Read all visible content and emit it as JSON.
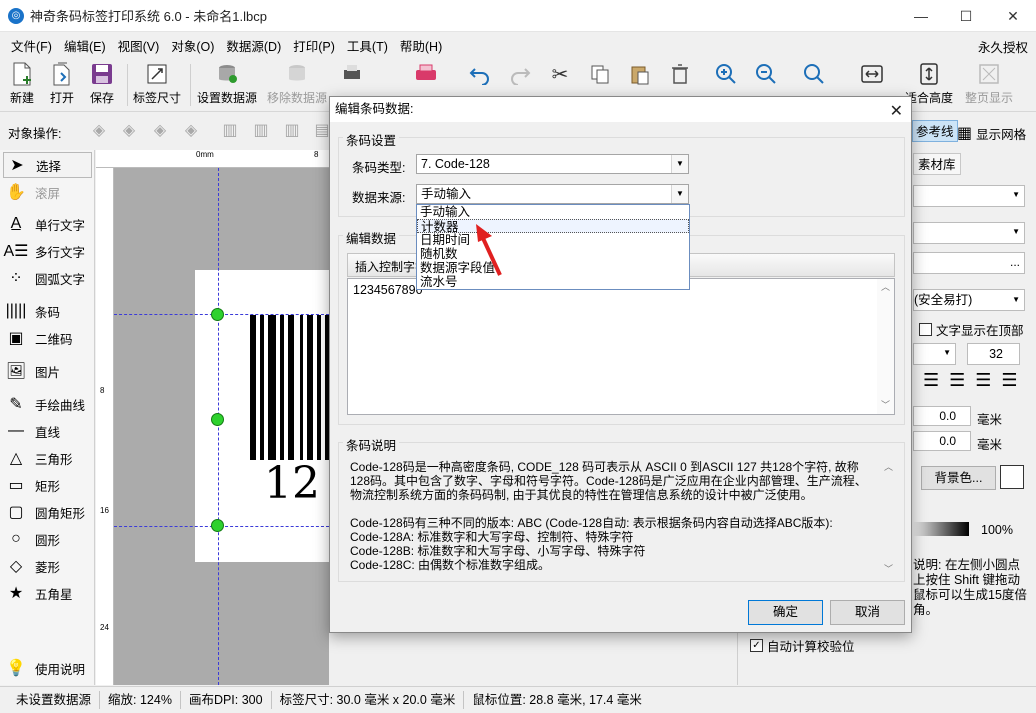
{
  "window": {
    "title": "神奇条码标签打印系统 6.0 - 未命名1.lbcp",
    "logo_glyph": "◎",
    "controls": {
      "minimize": "—",
      "maximize": "☐",
      "close": "✕"
    }
  },
  "menu": {
    "items": [
      "文件(F)",
      "编辑(E)",
      "视图(V)",
      "对象(O)",
      "数据源(D)",
      "打印(P)",
      "工具(T)",
      "帮助(H)"
    ],
    "license": "永久授权"
  },
  "toolbar": {
    "new": "新建",
    "open": "打开",
    "save": "保存",
    "label_size": "标签尺寸",
    "set_datasource": "设置数据源",
    "remove_datasource": "移除数据源",
    "fit_height": "适合高度",
    "full_page": "整页显示"
  },
  "objops": {
    "label": "对象操作:",
    "guide_lines": "参考线",
    "show_grid": "显示网格"
  },
  "tools": {
    "select": "选择",
    "scroll": "滚屏",
    "single_text": "单行文字",
    "multi_text": "多行文字",
    "arc_text": "圆弧文字",
    "barcode": "条码",
    "qrcode": "二维码",
    "image": "图片",
    "freehand": "手绘曲线",
    "line": "直线",
    "triangle": "三角形",
    "rectangle": "矩形",
    "rounded_rect": "圆角矩形",
    "circle": "圆形",
    "diamond": "菱形",
    "star": "五角星",
    "help": "使用说明"
  },
  "canvas": {
    "ruler_top_0": "0mm",
    "ruler_top_8": "8",
    "ruler_left_8": "8",
    "ruler_left_16": "16",
    "ruler_left_24": "24",
    "barcode_text": "12"
  },
  "right_panel": {
    "tab_material": "素材库",
    "font_hint": "(安全易打)",
    "text_on_top": "文字显示在顶部",
    "font_size": "32",
    "val_1": "0.0",
    "val_2": "0.0",
    "unit": "毫米",
    "bg_color": "背景色...",
    "opacity": "100%",
    "hint_lines": [
      "说明: 在左侧小圆点",
      "上按住 Shift 键拖动",
      "鼠标可以生成15度倍",
      "角。"
    ],
    "auto_check": "自动计算校验位"
  },
  "statusbar": {
    "datasource": "未设置数据源",
    "zoom": "缩放: 124%",
    "dpi": "画布DPI: 300",
    "label_size": "标签尺寸: 30.0 毫米 x 20.0 毫米",
    "mouse_pos": "鼠标位置: 28.8 毫米, 17.4 毫米"
  },
  "dialog": {
    "title": "编辑条码数据:",
    "group_settings": "条码设置",
    "barcode_type_label": "条码类型:",
    "barcode_type_value": "7.  Code-128",
    "data_source_label": "数据来源:",
    "data_source_value": "手动输入",
    "dropdown_options": [
      "手动输入",
      "计数器",
      "日期时间",
      "随机数",
      "数据源字段值",
      "流水号"
    ],
    "group_edit": "编辑数据",
    "insert_control": "插入控制字符",
    "data_value": "1234567890",
    "group_desc": "条码说明",
    "desc_lines": [
      "Code-128码是一种高密度条码, CODE_128 码可表示从 ASCII 0 到ASCII 127 共128个字符, 故称",
      "128码。其中包含了数字、字母和符号字符。Code-128码是广泛应用在企业内部管理、生产流程、",
      "物流控制系统方面的条码码制, 由于其优良的特性在管理信息系统的设计中被广泛使用。",
      "",
      "Code-128码有三种不同的版本: ABC (Code-128自动: 表示根据条码内容自动选择ABC版本):",
      "Code-128A: 标准数字和大写字母、控制符、特殊字符",
      "Code-128B: 标准数字和大写字母、小写字母、特殊字符",
      "Code-128C: 由偶数个标准数字组成。"
    ],
    "ok": "确定",
    "cancel": "取消"
  }
}
